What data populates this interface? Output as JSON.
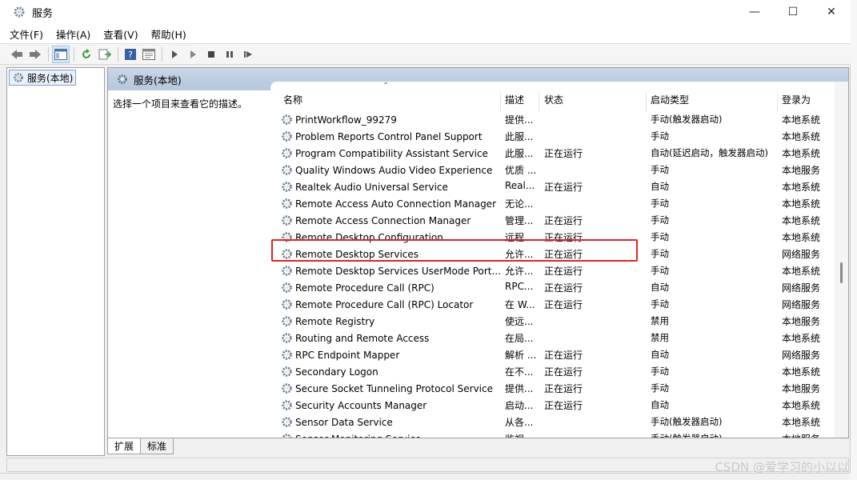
{
  "window": {
    "title": "服务",
    "controls": {
      "minimize": "—",
      "maximize": "☐",
      "close": "✕"
    }
  },
  "menu": [
    {
      "label": "文件(F)"
    },
    {
      "label": "操作(A)"
    },
    {
      "label": "查看(V)"
    },
    {
      "label": "帮助(H)"
    }
  ],
  "tree": {
    "root_label": "服务(本地)"
  },
  "right": {
    "header_label": "服务(本地)",
    "description_hint": "选择一个项目来查看它的描述。",
    "columns": {
      "name": "名称",
      "desc": "描述",
      "status": "状态",
      "startup": "启动类型",
      "login": "登录为"
    },
    "rows": [
      {
        "name": "PrintWorkflow_99279",
        "desc": "提供...",
        "status": "",
        "startup": "手动(触发器启动)",
        "login": "本地系统"
      },
      {
        "name": "Problem Reports Control Panel Support",
        "desc": "此服...",
        "status": "",
        "startup": "手动",
        "login": "本地系统"
      },
      {
        "name": "Program Compatibility Assistant Service",
        "desc": "此服...",
        "status": "正在运行",
        "startup": "自动(延迟启动，触发器启动)",
        "login": "本地系统"
      },
      {
        "name": "Quality Windows Audio Video Experience",
        "desc": "优质 ...",
        "status": "",
        "startup": "手动",
        "login": "本地服务"
      },
      {
        "name": "Realtek Audio Universal Service",
        "desc": "Real...",
        "status": "正在运行",
        "startup": "自动",
        "login": "本地系统"
      },
      {
        "name": "Remote Access Auto Connection Manager",
        "desc": "无论...",
        "status": "",
        "startup": "手动",
        "login": "本地系统"
      },
      {
        "name": "Remote Access Connection Manager",
        "desc": "管理...",
        "status": "正在运行",
        "startup": "手动",
        "login": "本地系统"
      },
      {
        "name": "Remote Desktop Configuration",
        "desc": "远程...",
        "status": "正在运行",
        "startup": "手动",
        "login": "本地系统"
      },
      {
        "name": "Remote Desktop Services",
        "desc": "允许...",
        "status": "正在运行",
        "startup": "手动",
        "login": "网络服务"
      },
      {
        "name": "Remote Desktop Services UserMode Port...",
        "desc": "允许...",
        "status": "正在运行",
        "startup": "手动",
        "login": "本地系统"
      },
      {
        "name": "Remote Procedure Call (RPC)",
        "desc": "RPC...",
        "status": "正在运行",
        "startup": "自动",
        "login": "网络服务"
      },
      {
        "name": "Remote Procedure Call (RPC) Locator",
        "desc": "在 W...",
        "status": "正在运行",
        "startup": "手动",
        "login": "网络服务"
      },
      {
        "name": "Remote Registry",
        "desc": "使远...",
        "status": "",
        "startup": "禁用",
        "login": "本地服务"
      },
      {
        "name": "Routing and Remote Access",
        "desc": "在局...",
        "status": "",
        "startup": "禁用",
        "login": "本地系统"
      },
      {
        "name": "RPC Endpoint Mapper",
        "desc": "解析 ...",
        "status": "正在运行",
        "startup": "自动",
        "login": "网络服务"
      },
      {
        "name": "Secondary Logon",
        "desc": "在不...",
        "status": "正在运行",
        "startup": "手动",
        "login": "本地系统"
      },
      {
        "name": "Secure Socket Tunneling Protocol Service",
        "desc": "提供...",
        "status": "正在运行",
        "startup": "手动",
        "login": "本地服务"
      },
      {
        "name": "Security Accounts Manager",
        "desc": "启动...",
        "status": "正在运行",
        "startup": "自动",
        "login": "本地系统"
      },
      {
        "name": "Sensor Data Service",
        "desc": "从各...",
        "status": "",
        "startup": "手动(触发器启动)",
        "login": "本地系统"
      },
      {
        "name": "Sensor Monitoring Service",
        "desc": "监视...",
        "status": "",
        "startup": "手动(触发器启动)",
        "login": "本地服务"
      }
    ]
  },
  "tabs": [
    {
      "label": "扩展"
    },
    {
      "label": "标准"
    }
  ],
  "watermark": "CSDN @爱学习的小以以",
  "colors": {
    "highlight": "#e52222",
    "header_band": "#b4c7dc"
  }
}
